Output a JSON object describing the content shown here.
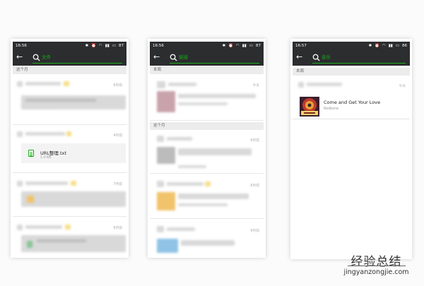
{
  "phones": [
    {
      "status": {
        "time": "16:56",
        "battery": "87"
      },
      "search_term": "文件",
      "sections": [
        "这个月"
      ],
      "dates": [
        "6月前",
        "4月前",
        "7月前",
        "6月前"
      ],
      "file": {
        "name": "URL整理.txt",
        "size": "1.0 KB"
      }
    },
    {
      "status": {
        "time": "16:56",
        "battery": "87"
      },
      "search_term": "链接",
      "sections": [
        "本周",
        "这个月"
      ],
      "dates": [
        "今天",
        "6月前",
        "6月前",
        "6月前"
      ]
    },
    {
      "status": {
        "time": "16:57",
        "battery": "86"
      },
      "search_term": "音乐",
      "sections": [
        "本周"
      ],
      "dates": [
        "今天"
      ],
      "song": {
        "title": "Come and Get Your Love",
        "artist": "Redbone"
      }
    }
  ],
  "watermark": {
    "text": "经验总结",
    "url": "jingyanzongjie.com"
  },
  "colors": {
    "accent": "#1aad19",
    "appbar": "#2b2d2f"
  }
}
